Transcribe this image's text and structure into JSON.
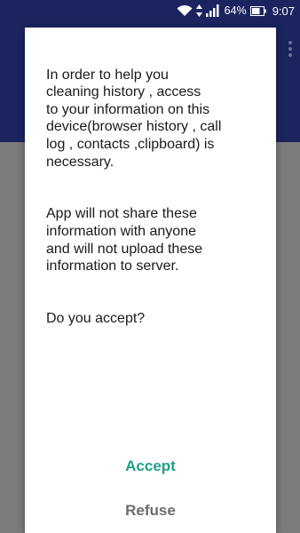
{
  "status_bar": {
    "battery": "64%",
    "time": "9:07",
    "icons": [
      "wifi-icon",
      "data-transfer-icon",
      "cell-signal-icon",
      "battery-icon"
    ]
  },
  "app_bar": {
    "overflow_icon": "overflow-menu-icon"
  },
  "dialog": {
    "paragraphs": [
      "In order to help you\ncleaning history , access\nto your information on this\ndevice(browser history , call\nlog , contacts ,clipboard) is\nnecessary.",
      "App will not share these\ninformation with anyone\nand will not upload these\ninformation to server.",
      "Do you accept?"
    ],
    "accept_label": "Accept",
    "refuse_label": "Refuse"
  },
  "colors": {
    "status_bar_bg": "#1b245e",
    "dim_background": "#7b7b7b",
    "dialog_bg": "#ffffff",
    "accept_color": "#1f9e8d",
    "refuse_color": "#6b6b6b"
  }
}
